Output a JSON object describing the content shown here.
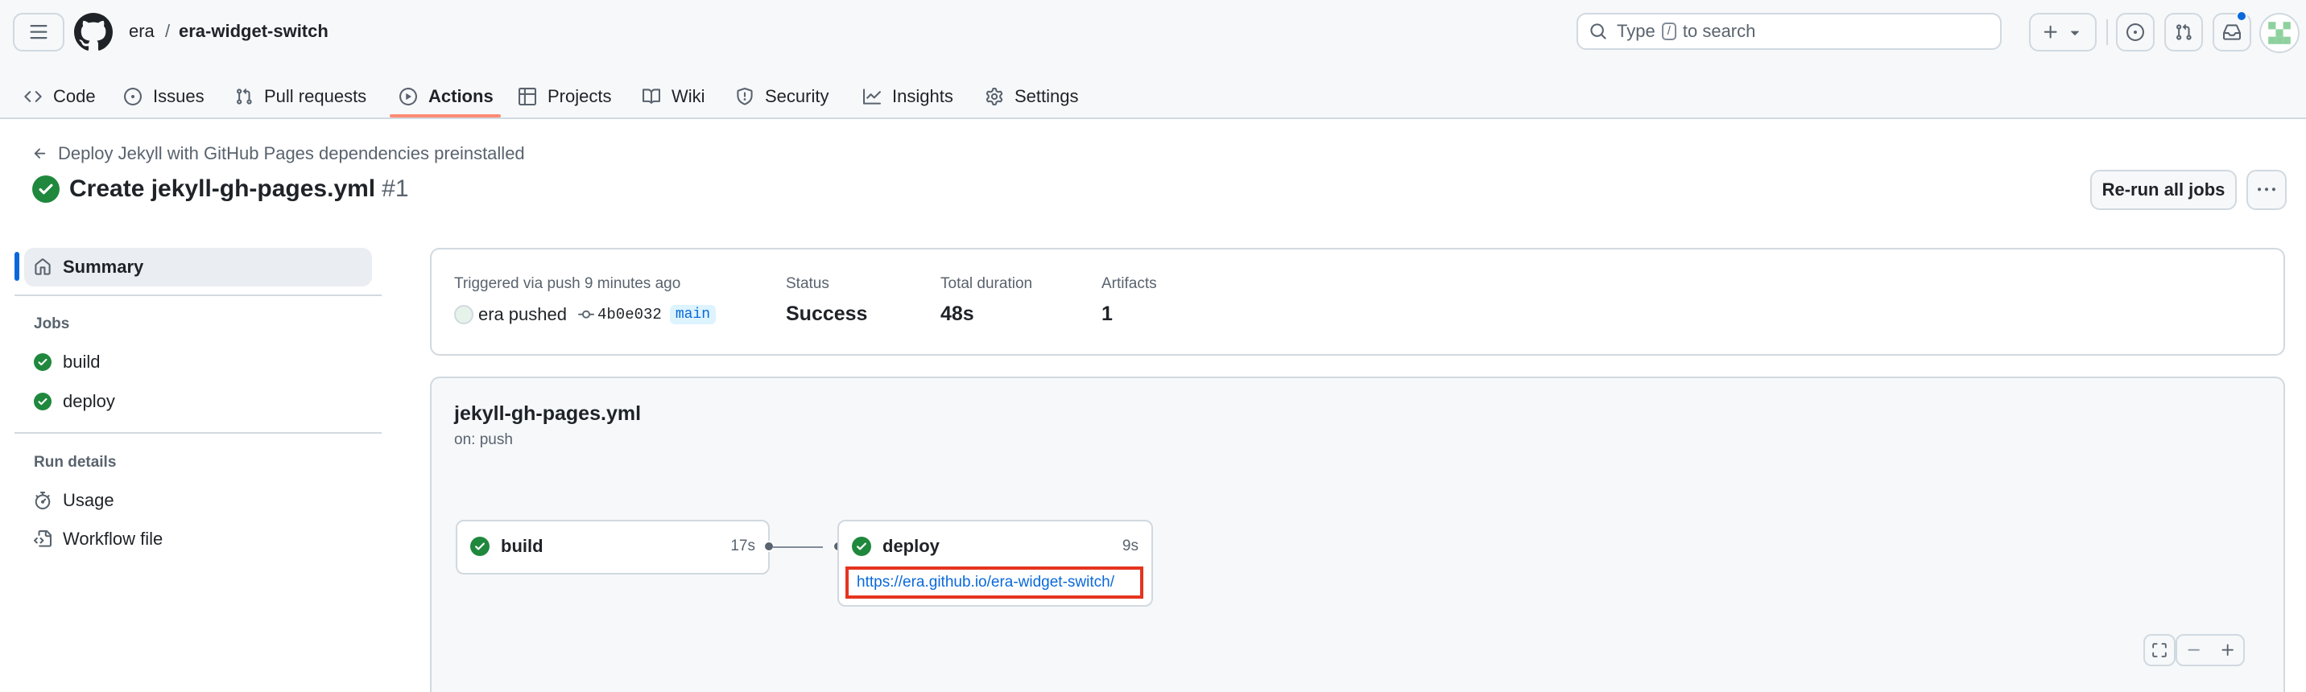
{
  "header": {
    "owner": "era",
    "separator": "/",
    "repo": "era-widget-switch",
    "search_pre": "Type",
    "search_key": "/",
    "search_post": "to search"
  },
  "tabs": [
    {
      "label": "Code",
      "icon": "code-icon"
    },
    {
      "label": "Issues",
      "icon": "issue-opened-icon"
    },
    {
      "label": "Pull requests",
      "icon": "git-pull-request-icon"
    },
    {
      "label": "Actions",
      "icon": "play-icon",
      "active": true
    },
    {
      "label": "Projects",
      "icon": "table-icon"
    },
    {
      "label": "Wiki",
      "icon": "book-icon"
    },
    {
      "label": "Security",
      "icon": "shield-icon"
    },
    {
      "label": "Insights",
      "icon": "graph-icon"
    },
    {
      "label": "Settings",
      "icon": "gear-icon"
    }
  ],
  "run": {
    "back_label": "Deploy Jekyll with GitHub Pages dependencies preinstalled",
    "title": "Create jekyll-gh-pages.yml",
    "number": "#1",
    "rerun_label": "Re-run all jobs"
  },
  "sidebar": {
    "summary_label": "Summary",
    "jobs_heading": "Jobs",
    "jobs": [
      "build",
      "deploy"
    ],
    "details_heading": "Run details",
    "usage_label": "Usage",
    "workflow_file_label": "Workflow file"
  },
  "summary": {
    "trigger_text": "Triggered via push 9 minutes ago",
    "actor": "era",
    "action": "pushed",
    "commit_sha": "4b0e032",
    "branch": "main",
    "status_label": "Status",
    "status_value": "Success",
    "duration_label": "Total duration",
    "duration_value": "48s",
    "artifacts_label": "Artifacts",
    "artifacts_value": "1"
  },
  "graph": {
    "workflow_name": "jekyll-gh-pages.yml",
    "trigger": "on: push",
    "jobs": [
      {
        "name": "build",
        "duration": "17s"
      },
      {
        "name": "deploy",
        "duration": "9s",
        "url": "https://era.github.io/era-widget-switch/"
      }
    ]
  },
  "colors": {
    "success": "#1f883d",
    "link": "#0969da",
    "accent_underline": "#fd8c73",
    "highlight_box": "#e5341f"
  }
}
